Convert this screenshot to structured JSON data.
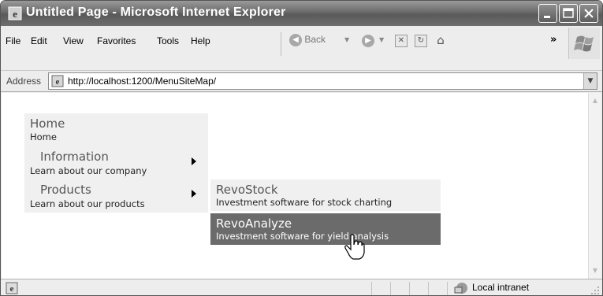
{
  "window": {
    "title": "Untitled Page - Microsoft Internet Explorer"
  },
  "menubar": {
    "items": [
      "File",
      "Edit",
      "View",
      "Favorites",
      "Tools",
      "Help"
    ]
  },
  "toolbar": {
    "back_label": "Back"
  },
  "address": {
    "label": "Address",
    "url": "http://localhost:1200/MenuSiteMap/"
  },
  "site_menu": {
    "items": [
      {
        "title": "Home",
        "description": "Home"
      },
      {
        "title": "Information",
        "description": "Learn about our company"
      },
      {
        "title": "Products",
        "description": "Learn about our products"
      }
    ],
    "products_submenu": [
      {
        "title": "RevoStock",
        "description": "Investment software for stock charting"
      },
      {
        "title": "RevoAnalyze",
        "description": "Investment software for yield analysis"
      }
    ]
  },
  "statusbar": {
    "zone": "Local intranet"
  },
  "colors": {
    "hover_highlight": "#6b6b6b",
    "menu_background": "#f0f0f0"
  }
}
